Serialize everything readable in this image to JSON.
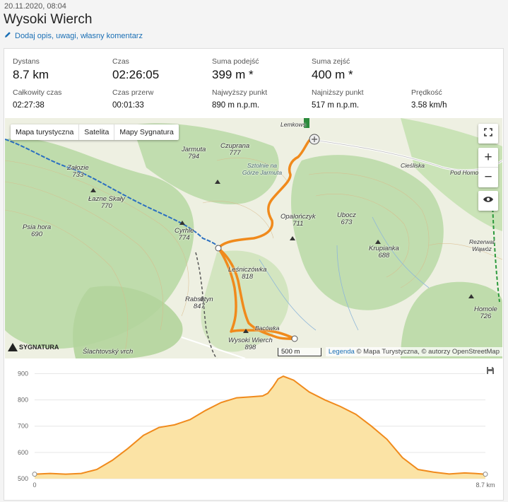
{
  "header": {
    "date": "20.11.2020, 08:04",
    "title": "Wysoki Wierch",
    "add_description": "Dodaj opis, uwagi, własny komentarz"
  },
  "stats": {
    "distance": {
      "label": "Dystans",
      "value": "8.7 km"
    },
    "time": {
      "label": "Czas",
      "value": "02:26:05"
    },
    "ascent": {
      "label": "Suma podejść",
      "value": "399 m *"
    },
    "descent": {
      "label": "Suma zejść",
      "value": "400 m *"
    },
    "total_time": {
      "label": "Całkowity czas",
      "value": "02:27:38"
    },
    "break_time": {
      "label": "Czas przerw",
      "value": "00:01:33"
    },
    "highest": {
      "label": "Najwyższy punkt",
      "value": "890 m n.p.m."
    },
    "lowest": {
      "label": "Najniższy punkt",
      "value": "517 m n.p.m."
    },
    "speed": {
      "label": "Prędkość",
      "value": "3.58 km/h"
    }
  },
  "map": {
    "tabs": [
      "Mapa turystyczna",
      "Satelita",
      "Mapy Sygnatura"
    ],
    "active_tab": "Mapa turystyczna",
    "scale": "500 m",
    "attribution_link": "Legenda",
    "attribution_text": "© Mapa Turystyczna, © autorzy OpenStreetMap",
    "logo": "SYGNATURA",
    "route_color": "#f08a1c",
    "labels": [
      {
        "name": "Załozie",
        "h": "733"
      },
      {
        "name": "Łazne Skały",
        "h": "770"
      },
      {
        "name": "Jarmuta",
        "h": "794"
      },
      {
        "name": "Czuprana",
        "h": "777"
      },
      {
        "name": "Psia hora",
        "h": "690"
      },
      {
        "name": "Cyrhle",
        "h": "774"
      },
      {
        "name": "Opalończyk",
        "h": "711"
      },
      {
        "name": "Ubocz",
        "h": "673"
      },
      {
        "name": "Krupianka",
        "h": "688"
      },
      {
        "name": "Rabsztyn",
        "h": "847"
      },
      {
        "name": "Homole",
        "h": "726"
      },
      {
        "name": "Wysoki Wierch",
        "h": "898"
      },
      {
        "name": "Bacówka",
        "h": ""
      },
      {
        "name": "Sztolnie na Górze Jarmuta",
        "h": ""
      },
      {
        "name": "Ślachtovský vrch",
        "h": ""
      },
      {
        "name": "Leśniczówka",
        "h": "818"
      },
      {
        "name": "Cieśliska",
        "h": ""
      },
      {
        "name": "Pod Homolami",
        "h": ""
      },
      {
        "name": "Rezerwat Wąwóz",
        "h": ""
      },
      {
        "name": "Lemkows",
        "h": ""
      }
    ]
  },
  "chart_data": {
    "type": "area",
    "xlabel": "",
    "ylabel": "",
    "x_tick_labels": [
      "0",
      "8.7 km"
    ],
    "y_ticks": [
      500,
      600,
      700,
      800,
      900
    ],
    "ylim": [
      500,
      920
    ],
    "xlim": [
      0,
      8.7
    ],
    "fill_color": "#fbe3a5",
    "line_color": "#f08a1c",
    "x": [
      0,
      0.3,
      0.6,
      0.9,
      1.2,
      1.5,
      1.8,
      2.1,
      2.4,
      2.7,
      3.0,
      3.3,
      3.6,
      3.9,
      4.2,
      4.4,
      4.5,
      4.6,
      4.7,
      4.8,
      5.0,
      5.3,
      5.6,
      5.9,
      6.2,
      6.5,
      6.8,
      7.1,
      7.4,
      7.7,
      8.0,
      8.3,
      8.5,
      8.7
    ],
    "y": [
      517,
      520,
      517,
      520,
      535,
      570,
      615,
      665,
      695,
      705,
      725,
      760,
      790,
      808,
      812,
      815,
      825,
      850,
      880,
      890,
      875,
      830,
      800,
      775,
      745,
      700,
      650,
      580,
      535,
      525,
      518,
      522,
      520,
      517
    ]
  }
}
